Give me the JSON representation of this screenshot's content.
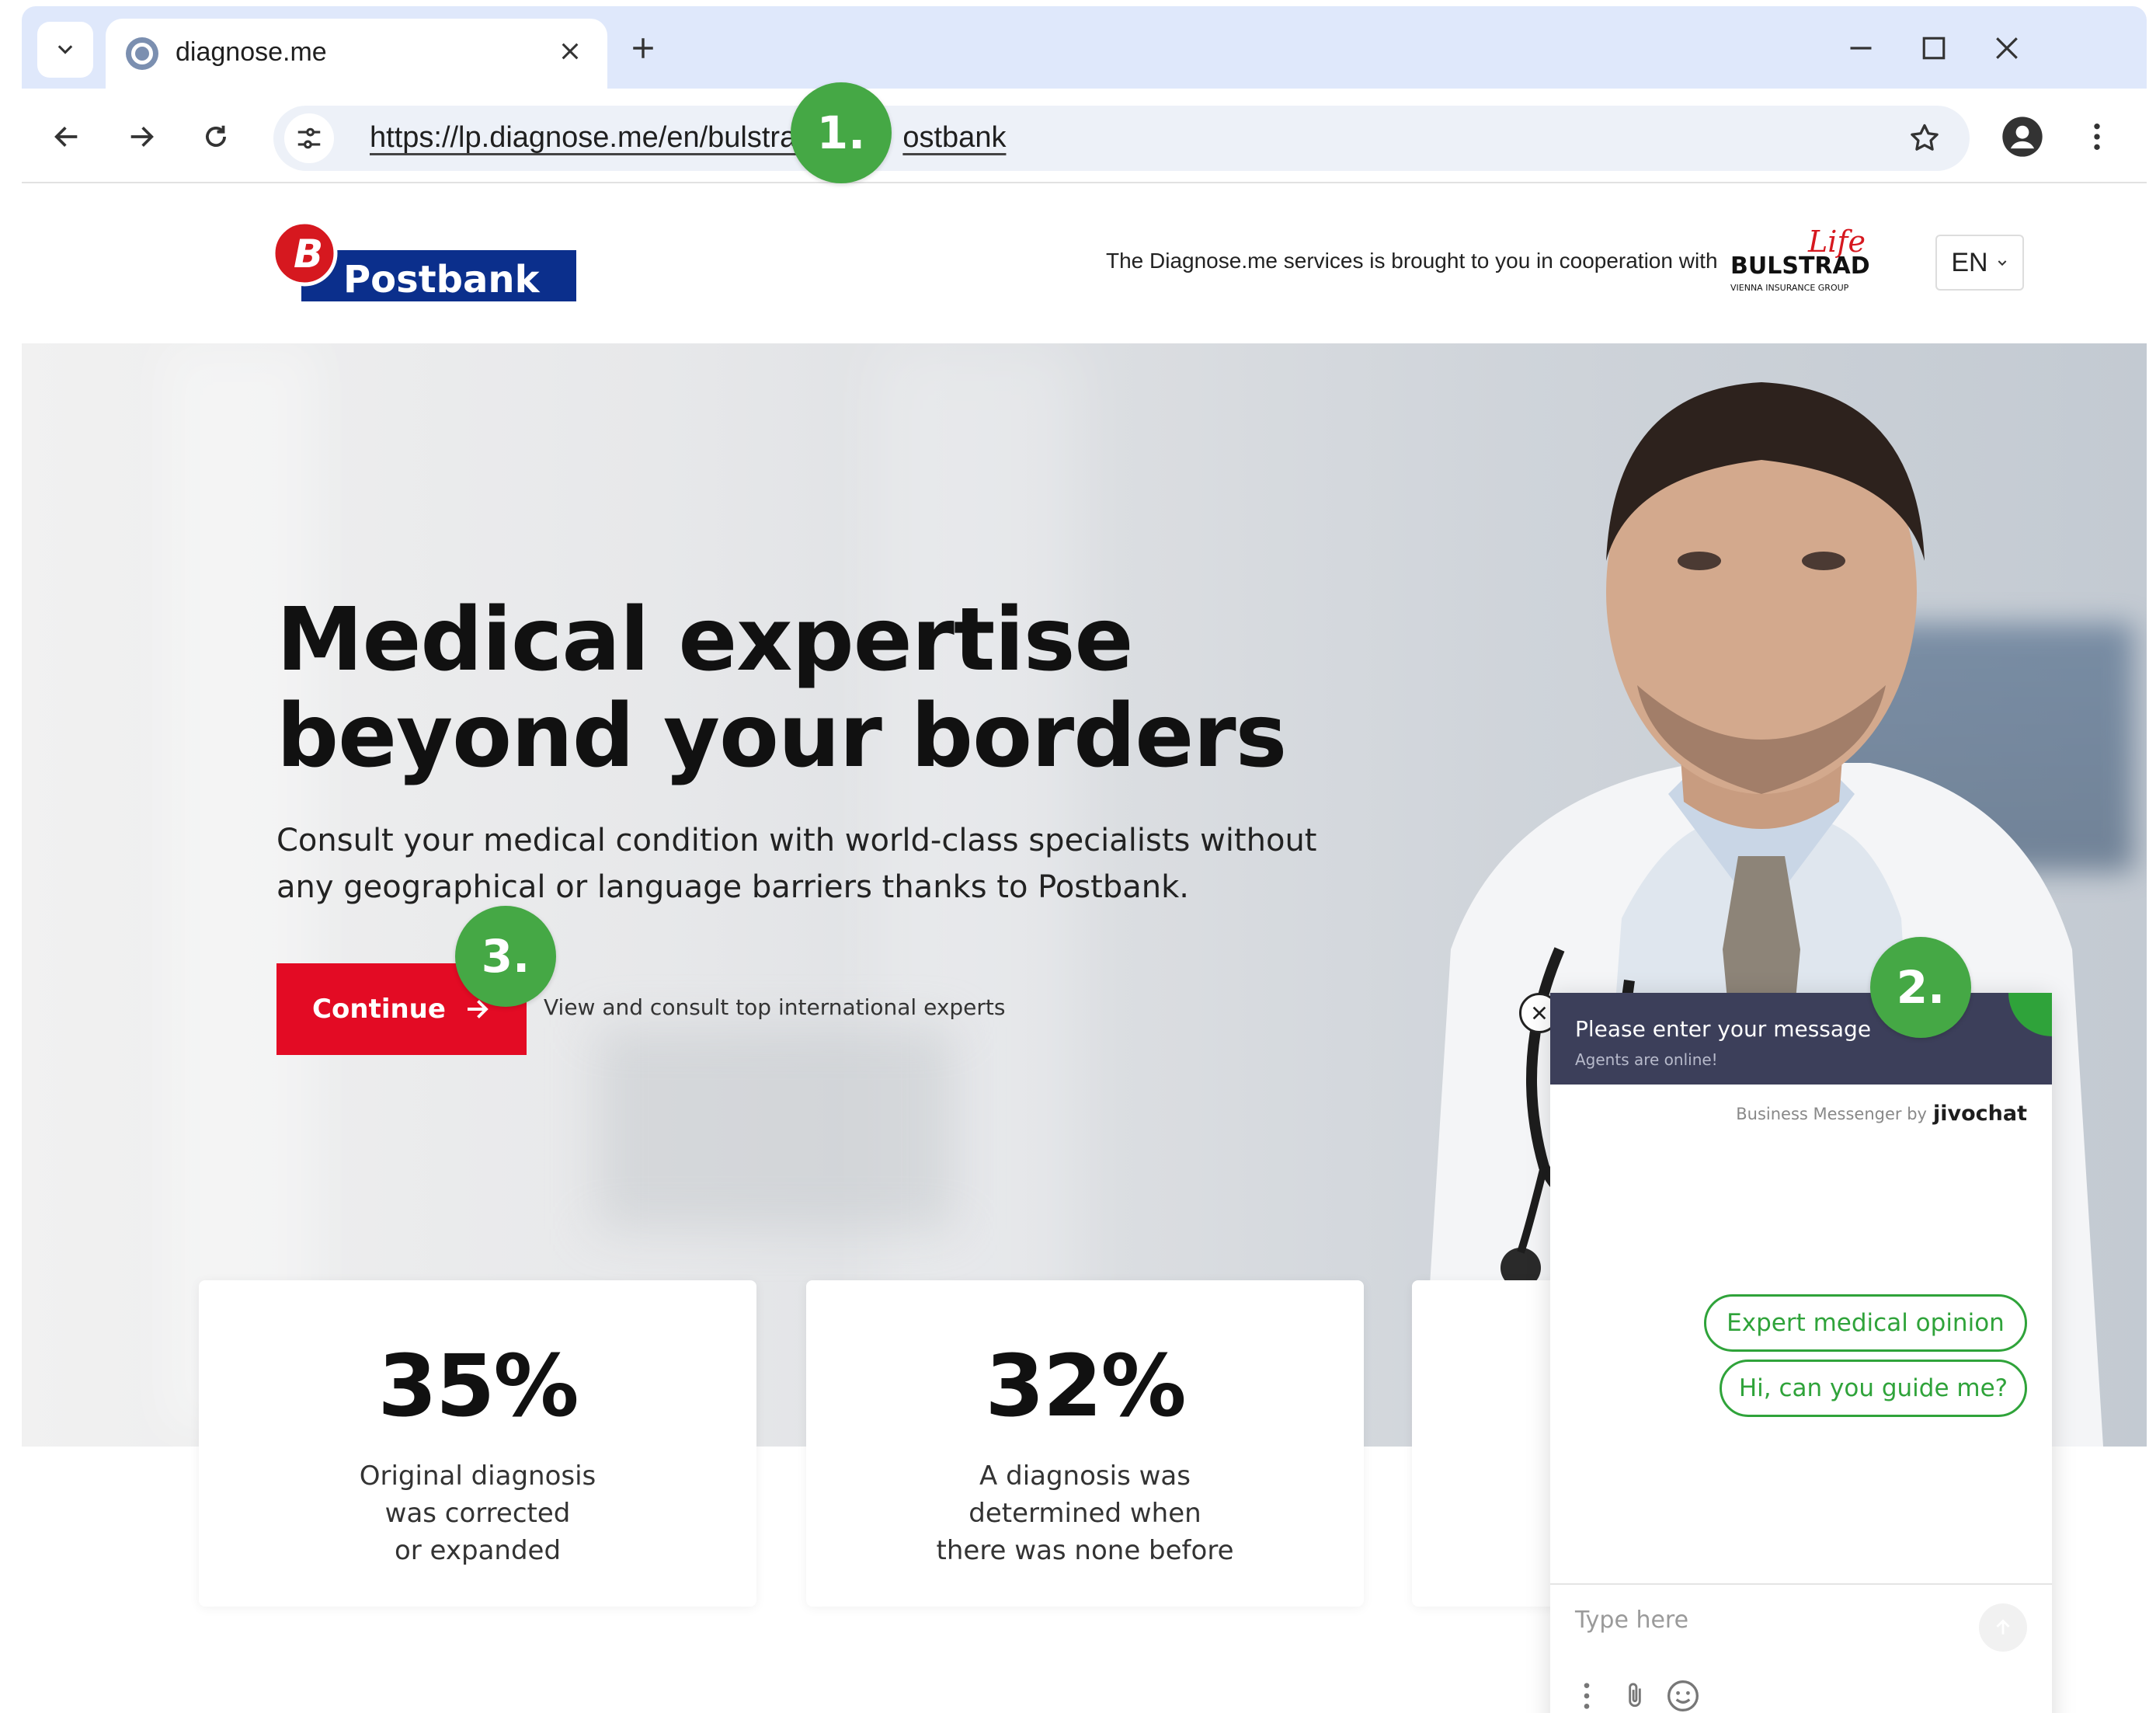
{
  "browser": {
    "tab_title": "diagnose.me",
    "url": "https://lp.diagnose.me/en/bulstrad-postbank",
    "url_display_left": "https://lp.diagnose.me/en/bulstrad",
    "url_display_right": "ostbank"
  },
  "header": {
    "logo_text": "Postbank",
    "coop_text": "The Diagnose.me services is brought to you in cooperation with",
    "partner_logo_text": "BULSTRAD",
    "partner_logo_script": "Life",
    "partner_logo_sub": "VIENNA INSURANCE GROUP",
    "language": "EN"
  },
  "hero": {
    "headline_line1": "Medical expertise",
    "headline_line2": "beyond your borders",
    "subhead_line1": "Consult your medical condition with world-class specialists without",
    "subhead_line2": "any geographical or language barriers thanks to Postbank.",
    "cta_label": "Continue",
    "cta_note": "View and consult top international experts"
  },
  "stats": [
    {
      "value": "35%",
      "description": "Original diagnosis\nwas corrected\nor expanded"
    },
    {
      "value": "32%",
      "description": "A diagnosis was\ndetermined when\nthere was none before"
    }
  ],
  "chat": {
    "title": "Please enter your message",
    "status": "Agents are online!",
    "brand_prefix": "Business Messenger by",
    "brand_name": "jivochat",
    "quick_replies": [
      "Expert medical opinion",
      "Hi, can you guide me?"
    ],
    "input_placeholder": "Type here"
  },
  "annotations": [
    "1.",
    "2.",
    "3."
  ],
  "colors": {
    "accent_red": "#e30b24",
    "annotation_green": "#45a845",
    "chat_header": "#3c3f5a",
    "chat_green": "#2fa33a",
    "postbank_blue": "#0b2f8c"
  }
}
